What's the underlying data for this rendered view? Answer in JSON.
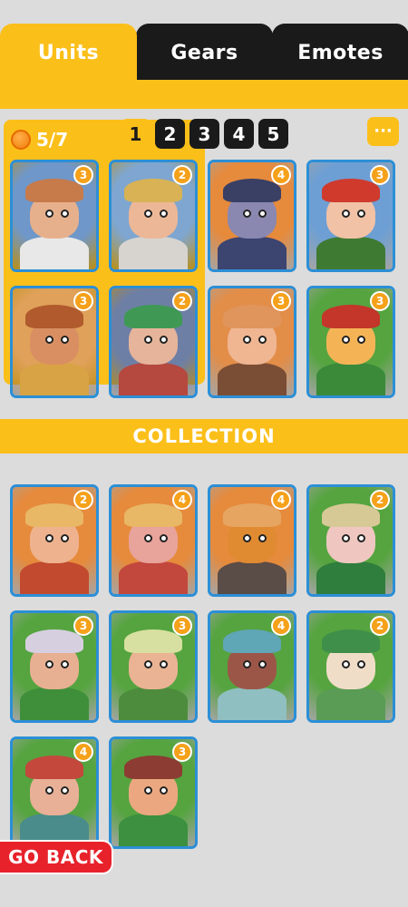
{
  "tabs": [
    {
      "label": "Units",
      "active": true
    },
    {
      "label": "Gears",
      "active": false
    },
    {
      "label": "Emotes",
      "active": false
    }
  ],
  "team": {
    "count": "5/7",
    "pages": [
      "1",
      "2",
      "3",
      "4",
      "5"
    ],
    "active_page": "1",
    "more_label": "···"
  },
  "collection_title": "COLLECTION",
  "go_back": "GO BACK",
  "colors": {
    "accent": "#fbbf1a",
    "dark": "#1a1a1a",
    "card_border": "#2c8fd6",
    "badge": "#f5a11a",
    "back": "#e8222b"
  },
  "team_cards": [
    {
      "level": "3",
      "bg": "#6f97c9",
      "hair": "#c77a4a",
      "skin": "#e7b08d",
      "body": "#e8e8e8"
    },
    {
      "level": "2",
      "bg": "#7fa6d0",
      "hair": "#d8b254",
      "skin": "#ecb796",
      "body": "#d7d4d0"
    },
    {
      "level": "4",
      "bg": "#e68a3c",
      "hair": "#3a3f64",
      "skin": "#8a88b0",
      "body": "#3c4470"
    },
    {
      "level": "3",
      "bg": "#6d9fd4",
      "hair": "#cf3a2d",
      "skin": "#f1c2a6",
      "body": "#3f7a33"
    },
    {
      "level": "3",
      "bg": "#e0a15a",
      "hair": "#b05a2d",
      "skin": "#d98f62",
      "body": "#d8a345"
    },
    {
      "level": "2",
      "bg": "#6e7fa6",
      "hair": "#3f9955",
      "skin": "#e6b49a",
      "body": "#b5483f"
    },
    {
      "level": "3",
      "bg": "#e28d48",
      "hair": "#e0955c",
      "skin": "#f0b591",
      "body": "#7a4d35"
    },
    {
      "level": "3",
      "bg": "#55a43f",
      "hair": "#c4352a",
      "skin": "#f4b456",
      "body": "#3a8a3a"
    }
  ],
  "collection_cards": [
    {
      "level": "2",
      "bg": "#e68a3c",
      "hair": "#e8b866",
      "skin": "#eeb28e",
      "body": "#c24a2f"
    },
    {
      "level": "4",
      "bg": "#e68a3c",
      "hair": "#e8b866",
      "skin": "#e8a39b",
      "body": "#c2473c"
    },
    {
      "level": "4",
      "bg": "#e68a3c",
      "hair": "#e6a662",
      "skin": "#e08a32",
      "body": "#5a4c46"
    },
    {
      "level": "2",
      "bg": "#55a43f",
      "hair": "#d7c996",
      "skin": "#efc7c0",
      "body": "#2f7e3d"
    },
    {
      "level": "3",
      "bg": "#55a43f",
      "hair": "#d6cfe0",
      "skin": "#e8b092",
      "body": "#3f8f3a"
    },
    {
      "level": "3",
      "bg": "#55a43f",
      "hair": "#d7e0a0",
      "skin": "#eab394",
      "body": "#4e8c3d"
    },
    {
      "level": "4",
      "bg": "#55a43f",
      "hair": "#5fa6b6",
      "skin": "#9c5648",
      "body": "#8fbfc0"
    },
    {
      "level": "2",
      "bg": "#55a43f",
      "hair": "#3f8f4a",
      "skin": "#f0ddc8",
      "body": "#5a9c55"
    },
    {
      "level": "4",
      "bg": "#55a43f",
      "hair": "#c4483c",
      "skin": "#e8b096",
      "body": "#4a8c8c"
    },
    {
      "level": "3",
      "bg": "#55a43f",
      "hair": "#8c3c32",
      "skin": "#eba880",
      "body": "#3c9040"
    }
  ]
}
